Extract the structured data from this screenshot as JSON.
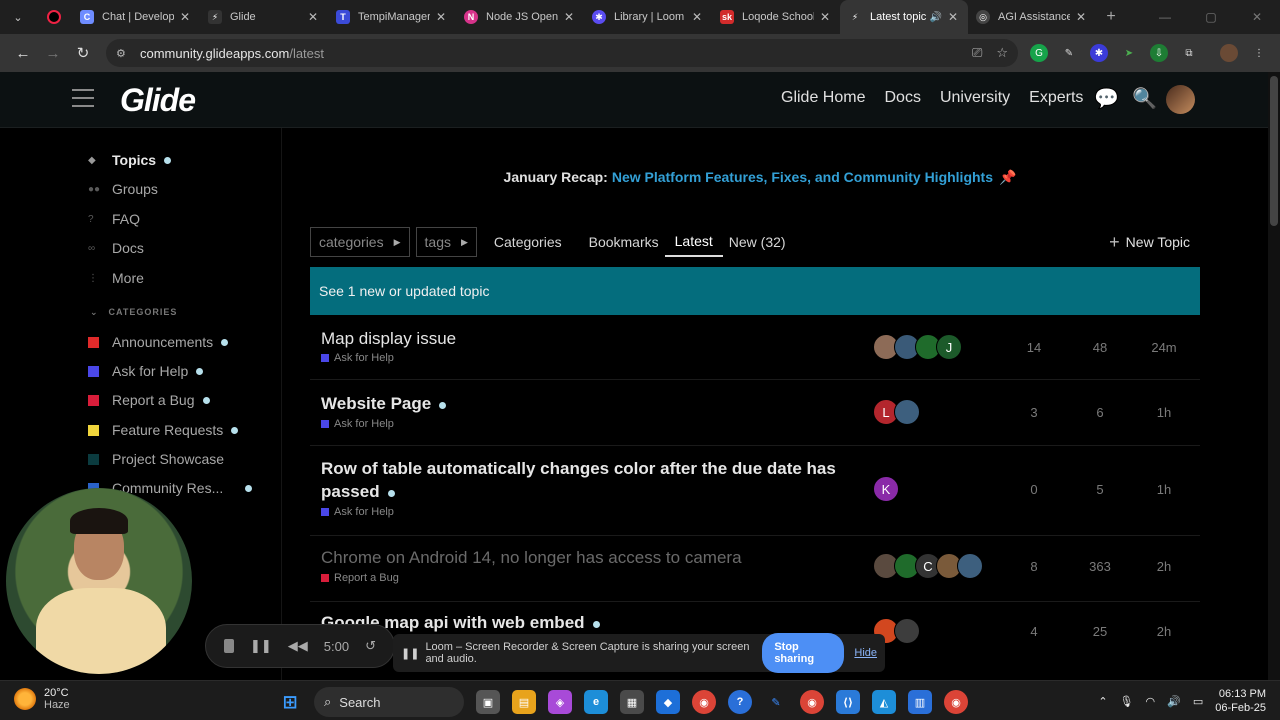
{
  "browser": {
    "tabs": [
      {
        "label": "Chat | Develop",
        "color": "#6e8cff",
        "glyph": "C"
      },
      {
        "label": "Glide",
        "color": "#333333",
        "glyph": "⚡"
      },
      {
        "label": "TempiManager",
        "color": "#3b4bd8",
        "glyph": "T"
      },
      {
        "label": "Node JS Open",
        "color": "#d6338a",
        "glyph": "N"
      },
      {
        "label": "Library | Loom",
        "color": "#5a4cf0",
        "glyph": "✱"
      },
      {
        "label": "Loqode School",
        "color": "#d22b2b",
        "glyph": "sk"
      },
      {
        "label": "Latest topic",
        "color": "#333333",
        "glyph": "⚡"
      },
      {
        "label": "AGI Assistance",
        "color": "#444444",
        "glyph": "◎"
      }
    ],
    "url_host": "community.glideapps.com",
    "url_path": "/latest"
  },
  "header": {
    "logo": "Glide",
    "links": [
      "Glide Home",
      "Docs",
      "University",
      "Experts"
    ]
  },
  "sidebar": {
    "items": [
      {
        "label": "Topics",
        "icon": "layers-icon"
      },
      {
        "label": "Groups",
        "icon": "users-icon"
      },
      {
        "label": "FAQ",
        "icon": "question-icon"
      },
      {
        "label": "Docs",
        "icon": "link-icon"
      },
      {
        "label": "More",
        "icon": "more-icon"
      }
    ],
    "categories_header": "CATEGORIES",
    "categories": [
      {
        "label": "Announcements",
        "color": "#e02a2a"
      },
      {
        "label": "Ask for Help",
        "color": "#4a47e8"
      },
      {
        "label": "Report a Bug",
        "color": "#d81d3a"
      },
      {
        "label": "Feature Requests",
        "color": "#f0d53c"
      },
      {
        "label": "Project Showcase",
        "color": "#0b3b3f"
      },
      {
        "label": "Community Res...",
        "color": "#2a62c9"
      }
    ]
  },
  "banner": {
    "prefix": "January Recap:",
    "link": "New Platform Features, Fixes, and Community Highlights"
  },
  "nav": {
    "categories_dd": "categories",
    "tags_dd": "tags",
    "tabs": [
      "Categories",
      "Bookmarks",
      "Latest",
      "New (32)"
    ],
    "new_topic": "New Topic"
  },
  "alert": "See 1 new or updated topic",
  "topics": [
    {
      "title": "Map display issue",
      "category": "Ask for Help",
      "catcolor": "#4a47e8",
      "replies": "14",
      "views": "48",
      "activity": "24m"
    },
    {
      "title": "Website Page",
      "category": "Ask for Help",
      "catcolor": "#4a47e8",
      "replies": "3",
      "views": "6",
      "activity": "1h"
    },
    {
      "title": "Row of table automatically changes color after the due date has passed",
      "category": "Ask for Help",
      "catcolor": "#4a47e8",
      "replies": "0",
      "views": "5",
      "activity": "1h"
    },
    {
      "title": "Chrome on Android 14, no longer has access to camera",
      "category": "Report a Bug",
      "catcolor": "#d81d3a",
      "replies": "8",
      "views": "363",
      "activity": "2h"
    },
    {
      "title": "Google map api with web embed",
      "category": "",
      "catcolor": "#4a47e8",
      "replies": "4",
      "views": "25",
      "activity": "2h"
    }
  ],
  "loom": {
    "timer": "5:00",
    "share_text": "Loom – Screen Recorder & Screen Capture is sharing your screen and audio.",
    "stop_label": "Stop sharing",
    "hide_label": "Hide"
  },
  "taskbar": {
    "temp": "20°C",
    "weather": "Haze",
    "search": "Search",
    "time": "06:13 PM",
    "date": "06-Feb-25"
  }
}
